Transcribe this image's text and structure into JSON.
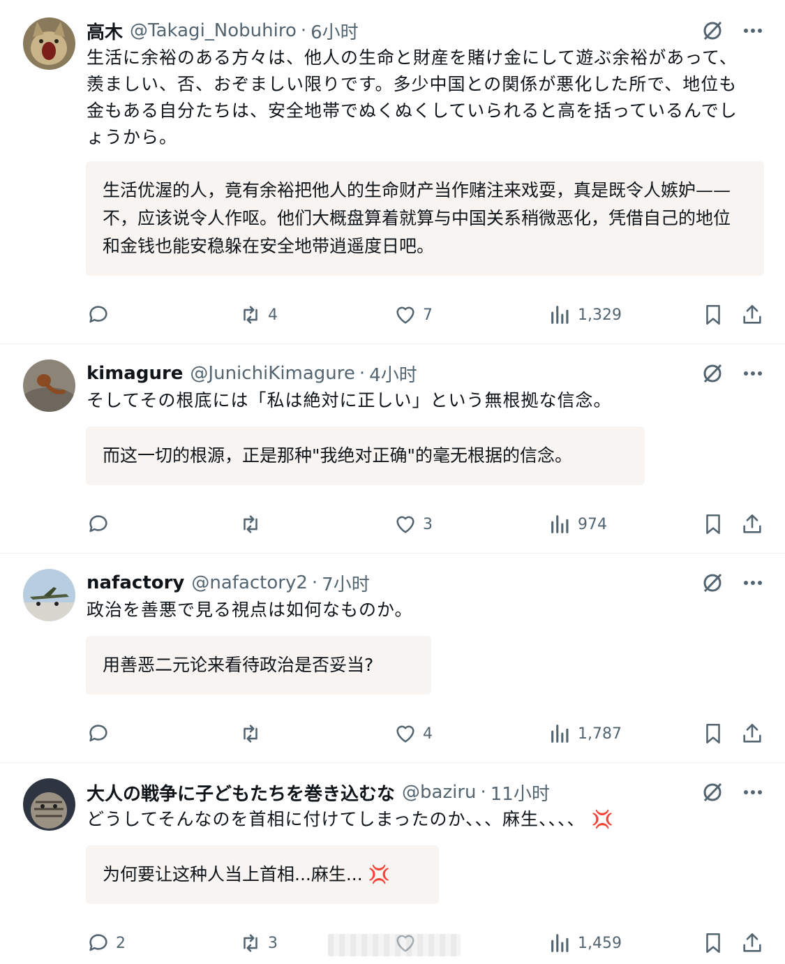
{
  "tweets": [
    {
      "name": "高木",
      "handle": "@Takagi_Nobuhiro",
      "time": "6小时",
      "text": "生活に余裕のある方々は、他人の生命と財産を賭け金にして遊ぶ余裕があって、羨ましい、否、おぞましい限りです。多少中国との関係が悪化した所で、地位も金もある自分たちは、安全地帯でぬくぬくしていられると高を括っているんでしょうから。",
      "translation": "生活优渥的人，竟有余裕把他人的生命财产当作赌注来戏耍，真是既令人嫉妒——不，应该说令人作呕。他们大概盘算着就算与中国关系稍微恶化，凭借自己的地位和金钱也能安稳躲在安全地带逍遥度日吧。",
      "replies": "",
      "retweets": "4",
      "likes": "7",
      "views": "1,329",
      "avatar_icon": "cat-avatar"
    },
    {
      "name": "kimagure",
      "handle": "@JunichiKimagure",
      "time": "4小时",
      "text": "そしてその根底には「私は絶対に正しい」という無根拠な信念。",
      "translation": "而这一切的根源，正是那种\"我绝对正确\"的毫无根据的信念。",
      "replies": "",
      "retweets": "",
      "likes": "3",
      "views": "974",
      "avatar_icon": "pipe-avatar"
    },
    {
      "name": "nafactory",
      "handle": "@nafactory2",
      "time": "7小时",
      "text": "政治を善悪で見る視点は如何なものか。",
      "translation": "用善恶二元论来看待政治是否妥当?",
      "replies": "",
      "retweets": "",
      "likes": "4",
      "views": "1,787",
      "avatar_icon": "airplane-avatar"
    },
    {
      "name": "大人の戦争に子どもたちを巻き込むな",
      "handle": "@baziru",
      "time": "11小时",
      "text": "どうしてそんなのを首相に付けてしまったのか、、、麻生、、、、",
      "translation": "为何要让这种人当上首相...麻生...",
      "replies": "2",
      "retweets": "3",
      "likes": "",
      "views": "1,459",
      "avatar_icon": "tabby-cat-avatar",
      "emoji": "💢"
    }
  ],
  "separator": "·",
  "colors": {
    "secondary_text": "#536471",
    "translation_bg": "#f7f4f2",
    "divider": "#eff3f4"
  }
}
